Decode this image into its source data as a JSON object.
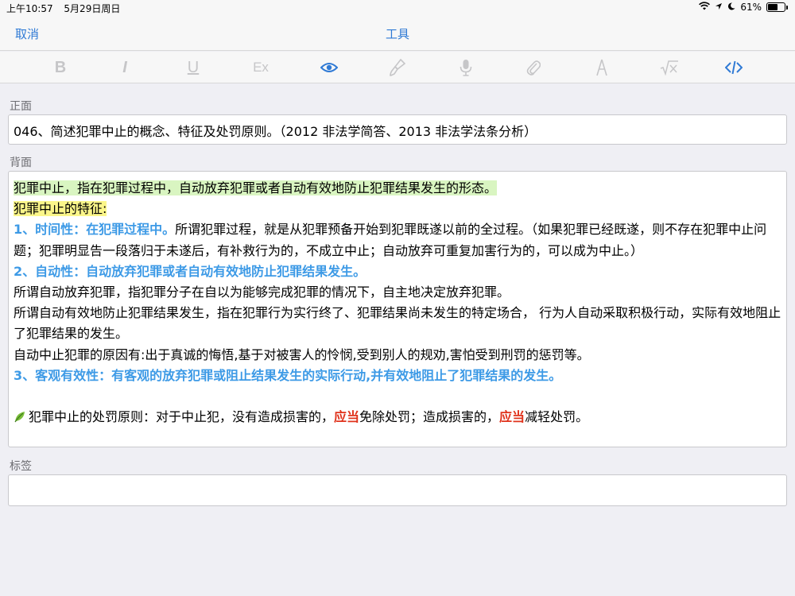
{
  "status": {
    "time": "上午10:57",
    "date": "5月29日周日",
    "battery_text": "61%",
    "battery_level": 0.61
  },
  "nav": {
    "cancel": "取消",
    "title": "工具"
  },
  "toolbar": {
    "tools": [
      {
        "label": "B",
        "icon": "bold-icon"
      },
      {
        "label": "I",
        "icon": "italic-icon"
      },
      {
        "label": "U",
        "icon": "underline-icon"
      },
      {
        "label": "Ex",
        "icon": "clear-format-icon"
      },
      {
        "icon": "eye-icon",
        "active": true
      },
      {
        "icon": "brush-icon"
      },
      {
        "icon": "microphone-icon"
      },
      {
        "icon": "paperclip-icon"
      },
      {
        "icon": "pen-icon"
      },
      {
        "icon": "sqrt-icon"
      },
      {
        "icon": "code-icon",
        "active": true
      }
    ]
  },
  "front": {
    "label": "正面",
    "text": "046、简述犯罪中止的概念、特征及处罚原则。（2012 非法学简答、2013 非法学法条分析）"
  },
  "back": {
    "label": "背面",
    "line1": "犯罪中止，指在犯罪过程中，自动放弃犯罪或者自动有效地防止犯罪结果发生的形态。",
    "heading": "犯罪中止的特征:",
    "p1_bold": "1、时间性：在犯罪过程中。",
    "p1_text": "所谓犯罪过程，就是从犯罪预备开始到犯罪既遂以前的全过程。（如果犯罪已经既遂，则不存在犯罪中止问题；犯罪明显告一段落归于未遂后，有补救行为的，不成立中止；自动放弃可重复加害行为的，可以成为中止。）",
    "p2_bold": "2、自动性：自动放弃犯罪或者自动有效地防止犯罪结果发生。",
    "p2_line1": "所谓自动放弃犯罪，指犯罪分子在自以为能够完成犯罪的情况下，自主地决定放弃犯罪。",
    "p2_line2": "所谓自动有效地防止犯罪结果发生，指在犯罪行为实行终了、犯罪结果尚未发生的特定场合， 行为人自动采取积极行动，实际有效地阻止了犯罪结果的发生。",
    "p2_line3": "自动中止犯罪的原因有:出于真诚的悔悟,基于对被害人的怜悯,受到别人的规劝,害怕受到刑罚的惩罚等。",
    "p3_bold": "3、客观有效性：有客观的放弃犯罪或阻止结果发生的实际行动,并有效地阻止了犯罪结果的发生。",
    "punish_a": "犯罪中止的处罚原则：对于中止犯，没有造成损害的，",
    "punish_red1": "应当",
    "punish_b": "免除处罚；造成损害的，",
    "punish_red2": "应当",
    "punish_c": "减轻处罚。"
  },
  "tags": {
    "label": "标签",
    "value": ""
  }
}
